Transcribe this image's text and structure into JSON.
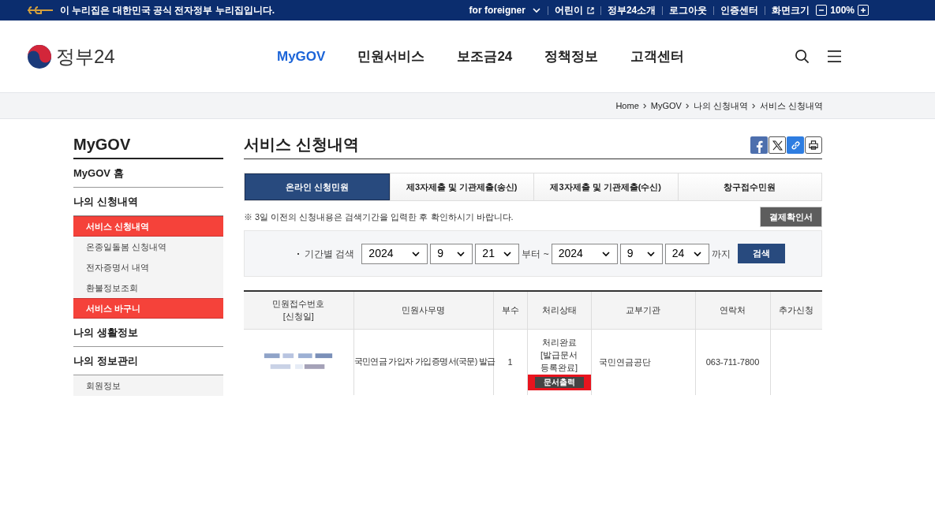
{
  "top_bar": {
    "notice": "이 누리집은 대한민국 공식 전자정부 누리집입니다.",
    "links": [
      {
        "label": "for foreigner",
        "kind": "dropdown"
      },
      {
        "label": "어린이",
        "kind": "external"
      },
      {
        "label": "정부24소개",
        "kind": "plain"
      },
      {
        "label": "로그아웃",
        "kind": "plain"
      },
      {
        "label": "인증센터",
        "kind": "plain"
      }
    ],
    "zoom": {
      "label": "화면크기",
      "value": "100%"
    }
  },
  "header": {
    "logo_text": "정부24",
    "nav": [
      {
        "label": "MyGOV",
        "selected": true
      },
      {
        "label": "민원서비스",
        "selected": false
      },
      {
        "label": "보조금24",
        "selected": false
      },
      {
        "label": "정책정보",
        "selected": false
      },
      {
        "label": "고객센터",
        "selected": false
      }
    ]
  },
  "breadcrumb": [
    "Home",
    "MyGOV",
    "나의 신청내역",
    "서비스 신청내역"
  ],
  "sidebar": {
    "title": "MyGOV",
    "sections": [
      {
        "label": "MyGOV 홈"
      },
      {
        "label": "나의 신청내역",
        "children": [
          {
            "label": "서비스 신청내역",
            "selected": true
          },
          {
            "label": "온종일돌봄 신청내역",
            "selected": false
          },
          {
            "label": "전자증명서 내역",
            "selected": false
          },
          {
            "label": "환불정보조회",
            "selected": false
          },
          {
            "label": "서비스 바구니",
            "selected": true
          }
        ]
      },
      {
        "label": "나의 생활정보"
      },
      {
        "label": "나의 정보관리",
        "children": [
          {
            "label": "회원정보",
            "selected": false
          }
        ]
      }
    ]
  },
  "main": {
    "title": "서비스 신청내역",
    "tabs": [
      {
        "label": "온라인 신청민원",
        "selected": true
      },
      {
        "label": "제3자제출 및 기관제출(송신)",
        "selected": false
      },
      {
        "label": "제3자제출 및 기관제출(수신)",
        "selected": false
      },
      {
        "label": "창구접수민원",
        "selected": false
      }
    ],
    "notice": "※ 3일 이전의 신청내용은 검색기간을 입력한 후 확인하시기 바랍니다.",
    "receipt_button": "결제확인서",
    "search": {
      "label": "기간별 검색",
      "from": [
        "2024",
        "9",
        "21"
      ],
      "from_suffix": "부터 ~",
      "to": [
        "2024",
        "9",
        "24"
      ],
      "to_suffix": "까지",
      "button": "검색"
    },
    "table": {
      "columns": [
        "민원접수번호\n[신청일]",
        "민원사무명",
        "부수",
        "처리상태",
        "교부기관",
        "연락처",
        "추가신청"
      ],
      "rows": [
        {
          "service": "국민연금 가입자 가입증명서(국문) 발급",
          "copies": "1",
          "status": "처리완료 [발급문서 등록완료]",
          "status_button": "문서출력",
          "agency": "국민연금공단",
          "phone": "063-711-7800"
        }
      ]
    }
  }
}
